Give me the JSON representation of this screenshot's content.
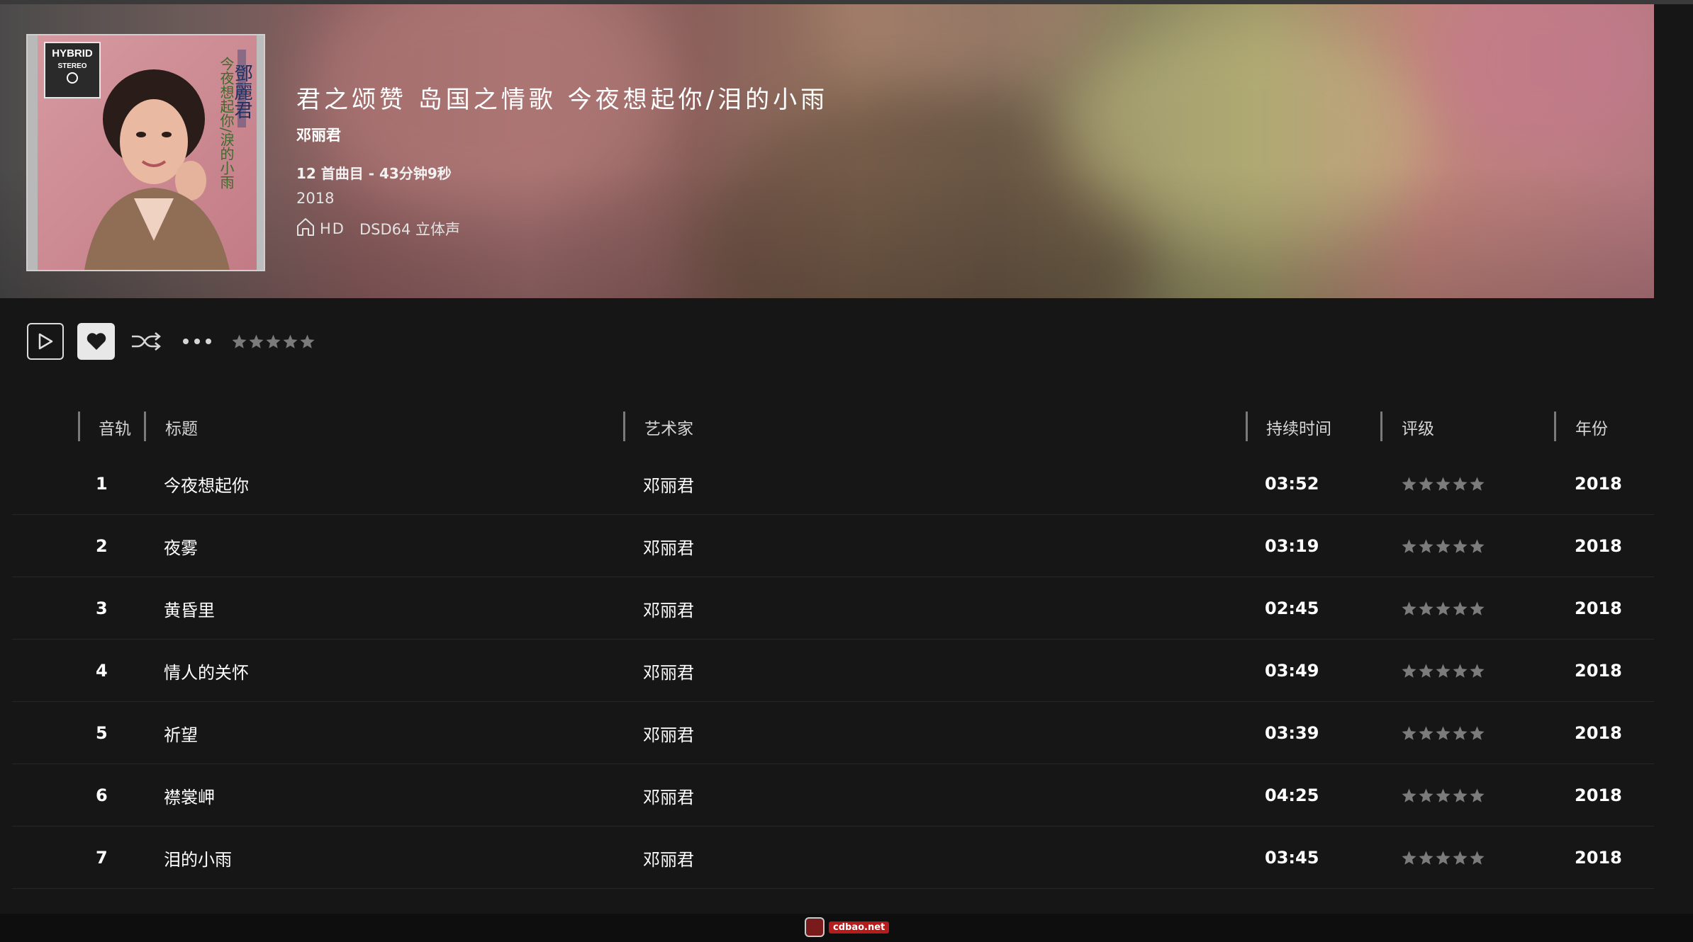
{
  "album": {
    "title": "君之颂赞 岛国之情歌 今夜想起你/泪的小雨",
    "artist": "邓丽君",
    "meta": "12 首曲目 - 43分钟9秒",
    "year": "2018",
    "quality_badge": "HD",
    "format": "DSD64 立体声",
    "cover_text": {
      "badge_line1": "HYBRID",
      "badge_line2": "STEREO",
      "artist_vertical": "鄧麗君",
      "title_vertical": "今夜想起你/淚的小雨"
    }
  },
  "controls": {
    "play": "play-icon",
    "favorite": "heart-icon",
    "shuffle": "shuffle-icon",
    "more": "more-icon",
    "rating_stars": 0
  },
  "table": {
    "headers": {
      "track": "音轨",
      "title": "标题",
      "artist": "艺术家",
      "duration": "持续时间",
      "rating": "评级",
      "year": "年份"
    },
    "rows": [
      {
        "track": "1",
        "title": "今夜想起你",
        "artist": "邓丽君",
        "duration": "03:52",
        "rating": 0,
        "year": "2018"
      },
      {
        "track": "2",
        "title": "夜雾",
        "artist": "邓丽君",
        "duration": "03:19",
        "rating": 0,
        "year": "2018"
      },
      {
        "track": "3",
        "title": "黄昏里",
        "artist": "邓丽君",
        "duration": "02:45",
        "rating": 0,
        "year": "2018"
      },
      {
        "track": "4",
        "title": "情人的关怀",
        "artist": "邓丽君",
        "duration": "03:49",
        "rating": 0,
        "year": "2018"
      },
      {
        "track": "5",
        "title": "祈望",
        "artist": "邓丽君",
        "duration": "03:39",
        "rating": 0,
        "year": "2018"
      },
      {
        "track": "6",
        "title": "襟裳岬",
        "artist": "邓丽君",
        "duration": "04:25",
        "rating": 0,
        "year": "2018"
      },
      {
        "track": "7",
        "title": "泪的小雨",
        "artist": "邓丽君",
        "duration": "03:45",
        "rating": 0,
        "year": "2018"
      }
    ]
  },
  "watermark": "cdbao.net",
  "colors": {
    "background": "#161616",
    "star_empty": "#7b7b7b",
    "text": "#ffffff"
  }
}
